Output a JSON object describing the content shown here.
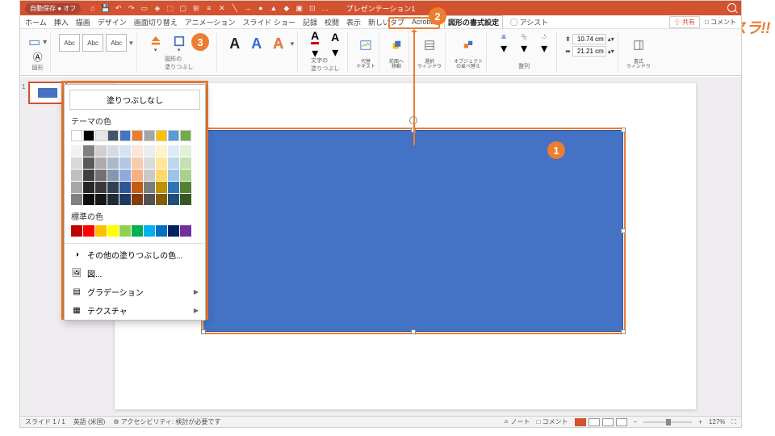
{
  "titlebar": {
    "autosave": "自動保存 ● オフ",
    "title": "プレゼンテーション1",
    "ellipsis": "…"
  },
  "tabs": {
    "items": [
      "ホーム",
      "挿入",
      "描画",
      "デザイン",
      "画面切り替え",
      "アニメーション",
      "スライド ショー",
      "記録",
      "校閲",
      "表示",
      "新しいタブ",
      "Acrobat"
    ],
    "active": "図形の書式設定",
    "assist": "◯ アシスト",
    "share": "共有",
    "comment": "□ コメント"
  },
  "ribbon": {
    "shapes_label": "図形",
    "abc": "Abc",
    "fill_label": "図形の\n塗りつぶし",
    "text_label": "文字の\n塗りつぶし",
    "alt_text": "代替\nテキスト",
    "to_front": "前面へ\n移動",
    "selection": "選択\nウィンドウ",
    "align": "オブジェクト\nの並べ替え",
    "arrange": "整列",
    "height_label": "10.74 cm",
    "width_label": "21.21 cm",
    "format_pane": "書式\nウィンドウ"
  },
  "fillpanel": {
    "nofill": "塗りつぶしなし",
    "theme_colors": "テーマの色",
    "standard_colors": "標準の色",
    "more_colors": "その他の塗りつぶしの色...",
    "picture": "図...",
    "gradient": "グラデーション",
    "texture": "テクスチャ",
    "theme_row1": [
      "#ffffff",
      "#000000",
      "#e7e6e6",
      "#44546a",
      "#4472c4",
      "#ed7d31",
      "#a5a5a5",
      "#ffc000",
      "#5b9bd5",
      "#70ad47"
    ],
    "theme_shades": [
      [
        "#f2f2f2",
        "#7f7f7f",
        "#d0cece",
        "#d6dce5",
        "#d9e2f3",
        "#fbe5d6",
        "#ededed",
        "#fff2cc",
        "#deebf7",
        "#e2f0d9"
      ],
      [
        "#d9d9d9",
        "#595959",
        "#aeabab",
        "#adb9ca",
        "#b4c7e7",
        "#f8cbad",
        "#dbdbdb",
        "#ffe699",
        "#bdd7ee",
        "#c5e0b4"
      ],
      [
        "#bfbfbf",
        "#404040",
        "#757070",
        "#8497b0",
        "#8faadc",
        "#f4b183",
        "#c9c9c9",
        "#ffd966",
        "#9dc3e6",
        "#a9d18e"
      ],
      [
        "#a6a6a6",
        "#262626",
        "#3b3838",
        "#333f50",
        "#2f5597",
        "#c55a11",
        "#7b7b7b",
        "#bf9000",
        "#2e75b6",
        "#548235"
      ],
      [
        "#808080",
        "#0d0d0d",
        "#171616",
        "#222a35",
        "#1f3864",
        "#843c0c",
        "#525252",
        "#806000",
        "#1f4e79",
        "#385723"
      ]
    ],
    "standard_row": [
      "#c00000",
      "#ff0000",
      "#ffc000",
      "#ffff00",
      "#92d050",
      "#00b050",
      "#00b0f0",
      "#0070c0",
      "#002060",
      "#7030a0"
    ]
  },
  "status": {
    "slide": "スライド 1 / 1",
    "lang": "英語 (米国)",
    "accessibility": "アクセシビリティ: 検討が必要です",
    "notes": "ノート",
    "comments": "コメント",
    "zoom": "127%"
  },
  "watermark": "シースラ!!"
}
